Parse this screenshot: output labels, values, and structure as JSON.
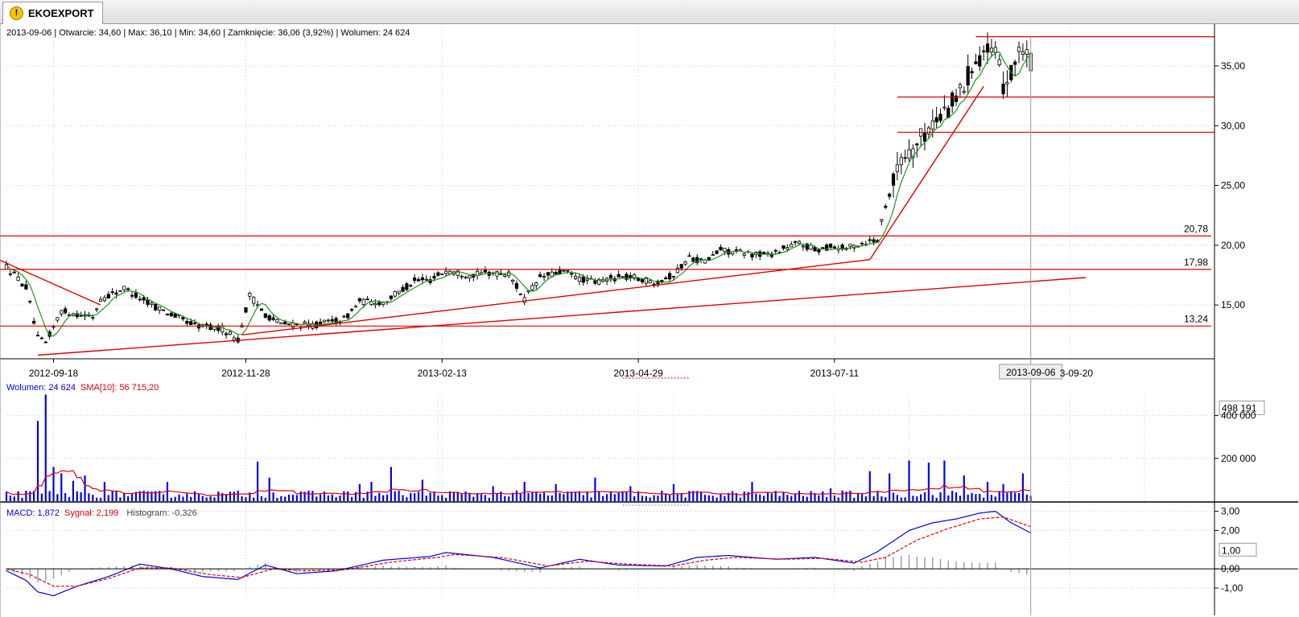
{
  "tab": {
    "title": "EKOEXPORT",
    "icon": "warning-icon"
  },
  "colors": {
    "up": "#ffffff",
    "down": "#000000",
    "sma": "#1a9a1a",
    "trend": "#e00000",
    "volume": "#0000ee",
    "macd": "#0000ee",
    "signal": "#e00000",
    "hist": "#8aa0b0"
  },
  "chart_data": [
    {
      "type": "candlestick",
      "header": "2013-09-06 | Otwarcie: 34,60 | Max: 36,10 | Min: 34,60 | Zamknięcie: 36,06 (3,92%)  | Wolumen: 24 624",
      "ylim": [
        10.5,
        38.5
      ],
      "y_ticks": [
        "35,00",
        "30,00",
        "25,00",
        "20,00",
        "15,00"
      ],
      "y_tick_values": [
        35,
        30,
        25,
        20,
        15
      ],
      "x_labels": [
        "2012-09-18",
        "2012-11-28",
        "2013-02-13",
        "2013-04-29",
        "2013-07-11"
      ],
      "x_label_index": [
        12,
        61,
        111,
        161,
        211
      ],
      "x_label_tail": "3-09-20",
      "cursor_label": "2013-09-06",
      "cursor_index": 261,
      "num_bars": 262,
      "x_span": 307,
      "grid": true,
      "anchors": [
        [
          0,
          18.2
        ],
        [
          5,
          16.5
        ],
        [
          8,
          12.2
        ],
        [
          10,
          11.8
        ],
        [
          14,
          14.5
        ],
        [
          22,
          14.0
        ],
        [
          24,
          15.5
        ],
        [
          30,
          16.4
        ],
        [
          36,
          15.2
        ],
        [
          42,
          14.2
        ],
        [
          48,
          13.3
        ],
        [
          55,
          13.0
        ],
        [
          59,
          12.1
        ],
        [
          62,
          15.8
        ],
        [
          66,
          14.2
        ],
        [
          70,
          13.4
        ],
        [
          78,
          13.3
        ],
        [
          86,
          13.8
        ],
        [
          90,
          15.3
        ],
        [
          96,
          15.2
        ],
        [
          100,
          16.1
        ],
        [
          104,
          17.0
        ],
        [
          108,
          17.1
        ],
        [
          112,
          17.9
        ],
        [
          118,
          17.5
        ],
        [
          124,
          17.7
        ],
        [
          128,
          17.6
        ],
        [
          132,
          15.5
        ],
        [
          136,
          17.3
        ],
        [
          142,
          17.8
        ],
        [
          146,
          17.2
        ],
        [
          150,
          16.9
        ],
        [
          155,
          17.3
        ],
        [
          160,
          17.3
        ],
        [
          165,
          16.9
        ],
        [
          170,
          17.5
        ],
        [
          174,
          19.0
        ],
        [
          178,
          18.6
        ],
        [
          182,
          19.6
        ],
        [
          188,
          19.3
        ],
        [
          194,
          19.2
        ],
        [
          198,
          19.7
        ],
        [
          202,
          20.2
        ],
        [
          206,
          19.6
        ],
        [
          210,
          19.9
        ],
        [
          214,
          19.7
        ],
        [
          218,
          20.2
        ],
        [
          222,
          20.5
        ],
        [
          224,
          23.4
        ],
        [
          228,
          27.2
        ],
        [
          232,
          28.5
        ],
        [
          236,
          30.2
        ],
        [
          240,
          31.5
        ],
        [
          244,
          33.2
        ],
        [
          246,
          35.2
        ],
        [
          249,
          36.2
        ],
        [
          252,
          35.8
        ],
        [
          254,
          33.5
        ],
        [
          256,
          34.2
        ],
        [
          258,
          36.6
        ],
        [
          260,
          35.6
        ],
        [
          261,
          36.06
        ]
      ],
      "last_candle": {
        "open": 34.6,
        "high": 36.1,
        "low": 34.6,
        "close": 36.06
      },
      "sma_label": "",
      "levels": [
        {
          "value": 20.78,
          "label": "20,78",
          "from": -5
        },
        {
          "value": 17.98,
          "label": "17,98",
          "from": -5
        },
        {
          "value": 13.24,
          "label": "13,24",
          "from": -5
        },
        {
          "value": 37.45,
          "label": "",
          "from": 247
        },
        {
          "value": 32.4,
          "label": "",
          "from": 227
        },
        {
          "value": 29.45,
          "label": "",
          "from": 227
        }
      ],
      "trendlines": [
        [
          [
            -2,
            18.8
          ],
          [
            24,
            15.0
          ]
        ],
        [
          [
            8,
            10.8
          ],
          [
            275,
            17.3
          ]
        ],
        [
          [
            60,
            12.5
          ],
          [
            220,
            18.8
          ],
          [
            249,
            33.3
          ]
        ]
      ]
    },
    {
      "type": "bar",
      "legend_volume": "Wolumen: 24 624",
      "legend_sma": "SMA[10]: 56 715,20",
      "ylim": [
        0,
        500000
      ],
      "y_ticks": [
        "400 000",
        "200 000"
      ],
      "y_tick_values": [
        400000,
        200000
      ],
      "max_label": "498 191",
      "spikes": [
        [
          8,
          375000
        ],
        [
          10,
          498191
        ],
        [
          12,
          160000
        ],
        [
          14,
          130000
        ],
        [
          17,
          95000
        ],
        [
          20,
          120000
        ],
        [
          25,
          90000
        ],
        [
          41,
          90000
        ],
        [
          64,
          185000
        ],
        [
          67,
          110000
        ],
        [
          90,
          80000
        ],
        [
          93,
          90000
        ],
        [
          98,
          160000
        ],
        [
          106,
          100000
        ],
        [
          124,
          70000
        ],
        [
          132,
          90000
        ],
        [
          140,
          80000
        ],
        [
          150,
          110000
        ],
        [
          159,
          70000
        ],
        [
          170,
          80000
        ],
        [
          190,
          90000
        ],
        [
          210,
          60000
        ],
        [
          220,
          140000
        ],
        [
          225,
          130000
        ],
        [
          230,
          190000
        ],
        [
          235,
          180000
        ],
        [
          239,
          190000
        ],
        [
          244,
          120000
        ],
        [
          250,
          90000
        ],
        [
          254,
          80000
        ],
        [
          259,
          130000
        ]
      ],
      "last_volume": 24624
    },
    {
      "type": "line",
      "legend_macd": "MACD: 1,872",
      "legend_signal": "Sygnał: 2,199",
      "legend_hist": "Histogram: -0,326",
      "ylim": [
        -1.5,
        3.4
      ],
      "y_ticks": [
        "3,00",
        "2,00",
        "0,00",
        "-1,00"
      ],
      "y_tick_values": [
        3,
        2,
        0,
        -1
      ],
      "current_label": "1,00",
      "macd_anchors": [
        [
          0,
          -0.1
        ],
        [
          5,
          -0.6
        ],
        [
          8,
          -1.2
        ],
        [
          12,
          -1.4
        ],
        [
          18,
          -0.9
        ],
        [
          26,
          -0.4
        ],
        [
          34,
          0.25
        ],
        [
          42,
          0.0
        ],
        [
          50,
          -0.4
        ],
        [
          59,
          -0.55
        ],
        [
          66,
          0.2
        ],
        [
          74,
          -0.25
        ],
        [
          84,
          -0.1
        ],
        [
          96,
          0.45
        ],
        [
          108,
          0.65
        ],
        [
          112,
          0.85
        ],
        [
          124,
          0.6
        ],
        [
          136,
          0.05
        ],
        [
          146,
          0.5
        ],
        [
          156,
          0.2
        ],
        [
          168,
          0.15
        ],
        [
          176,
          0.6
        ],
        [
          184,
          0.7
        ],
        [
          196,
          0.5
        ],
        [
          206,
          0.6
        ],
        [
          216,
          0.3
        ],
        [
          222,
          0.9
        ],
        [
          230,
          2.0
        ],
        [
          236,
          2.4
        ],
        [
          242,
          2.6
        ],
        [
          248,
          2.9
        ],
        [
          252,
          3.0
        ],
        [
          256,
          2.4
        ],
        [
          261,
          1.872
        ]
      ],
      "signal_anchors": [
        [
          0,
          0.0
        ],
        [
          6,
          -0.3
        ],
        [
          12,
          -0.9
        ],
        [
          18,
          -0.9
        ],
        [
          26,
          -0.5
        ],
        [
          34,
          0.05
        ],
        [
          42,
          0.05
        ],
        [
          52,
          -0.3
        ],
        [
          60,
          -0.45
        ],
        [
          68,
          0.0
        ],
        [
          76,
          -0.1
        ],
        [
          86,
          -0.05
        ],
        [
          98,
          0.35
        ],
        [
          110,
          0.6
        ],
        [
          114,
          0.75
        ],
        [
          126,
          0.6
        ],
        [
          138,
          0.15
        ],
        [
          148,
          0.4
        ],
        [
          158,
          0.25
        ],
        [
          170,
          0.15
        ],
        [
          178,
          0.45
        ],
        [
          186,
          0.6
        ],
        [
          198,
          0.5
        ],
        [
          208,
          0.55
        ],
        [
          218,
          0.35
        ],
        [
          224,
          0.6
        ],
        [
          232,
          1.5
        ],
        [
          240,
          2.1
        ],
        [
          248,
          2.6
        ],
        [
          254,
          2.7
        ],
        [
          261,
          2.199
        ]
      ]
    }
  ]
}
